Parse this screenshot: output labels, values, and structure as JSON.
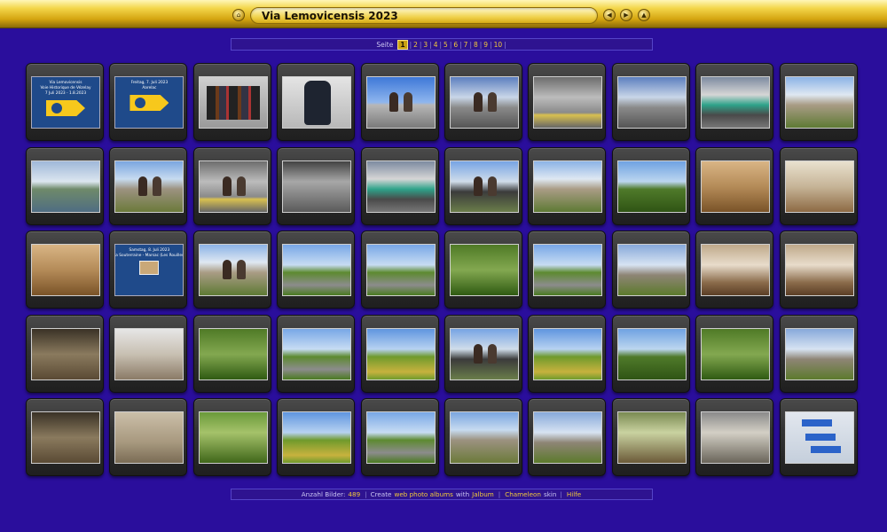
{
  "header": {
    "title": "Via Lemovicensis 2023",
    "icons": [
      "home-icon",
      "prev-icon",
      "play-icon",
      "up-icon"
    ]
  },
  "pagination": {
    "label": "Seite",
    "pages": [
      "1",
      "2",
      "3",
      "4",
      "5",
      "6",
      "7",
      "8",
      "9",
      "10"
    ],
    "current": "1"
  },
  "thumbnails": [
    {
      "scene": "title-slide",
      "lines": [
        "Via Lemovicensis",
        "Voie Historique de Vézelay",
        "7 Juli 2023 - 1.8.2023"
      ]
    },
    {
      "scene": "title-slide",
      "lines": [
        "Freitag, 7. Juli 2023",
        "Aarelac"
      ]
    },
    {
      "scene": "s-gear"
    },
    {
      "scene": "s-pack"
    },
    {
      "scene": "s-sky fig"
    },
    {
      "scene": "s-station fig"
    },
    {
      "scene": "s-hall"
    },
    {
      "scene": "s-station"
    },
    {
      "scene": "s-train"
    },
    {
      "scene": "s-village"
    },
    {
      "scene": "s-river"
    },
    {
      "scene": "s-street fig"
    },
    {
      "scene": "s-hall fig"
    },
    {
      "scene": "s-platform"
    },
    {
      "scene": "s-train"
    },
    {
      "scene": "s-people fig"
    },
    {
      "scene": "s-village"
    },
    {
      "scene": "s-green"
    },
    {
      "scene": "s-room"
    },
    {
      "scene": "s-room2"
    },
    {
      "scene": "s-room"
    },
    {
      "scene": "title-slide",
      "lines": [
        "Samstag, 8. Juli 2023",
        "La Souterraine - Marsac (Les Rouilles)"
      ],
      "pic": true
    },
    {
      "scene": "s-village fig"
    },
    {
      "scene": "s-road"
    },
    {
      "scene": "s-road"
    },
    {
      "scene": "s-sign"
    },
    {
      "scene": "s-road"
    },
    {
      "scene": "s-chapel"
    },
    {
      "scene": "s-church"
    },
    {
      "scene": "s-church"
    },
    {
      "scene": "s-interior"
    },
    {
      "scene": "s-table"
    },
    {
      "scene": "s-sign"
    },
    {
      "scene": "s-road"
    },
    {
      "scene": "s-field"
    },
    {
      "scene": "s-people fig"
    },
    {
      "scene": "s-field"
    },
    {
      "scene": "s-green"
    },
    {
      "scene": "s-sign"
    },
    {
      "scene": "s-chapel"
    },
    {
      "scene": "s-interior"
    },
    {
      "scene": "s-tympanum"
    },
    {
      "scene": "s-cross"
    },
    {
      "scene": "s-field"
    },
    {
      "scene": "s-road"
    },
    {
      "scene": "s-street"
    },
    {
      "scene": "s-chapel"
    },
    {
      "scene": "s-nave"
    },
    {
      "scene": "s-nave2"
    },
    {
      "scene": "s-signs"
    }
  ],
  "footer": {
    "count_label": "Anzahl Bilder:",
    "count": "489",
    "create": "Create",
    "web_albums": "web photo albums",
    "with": "with",
    "jalbum": "Jalbum",
    "skin": "Chameleon",
    "skin_word": "skin",
    "help": "Hilfe"
  },
  "colors": {
    "background": "#2a0e9c",
    "gold": "#f2c93a"
  }
}
